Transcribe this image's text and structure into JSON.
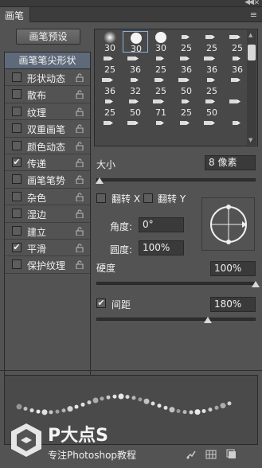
{
  "panel": {
    "tab_label": "画笔",
    "menu_icon": "panel-menu-icon"
  },
  "left": {
    "preset_button": "画笔预设",
    "header": "画笔笔尖形状",
    "options": [
      {
        "label": "形状动态",
        "checked": false,
        "checkmark": "",
        "locked": true
      },
      {
        "label": "散布",
        "checked": false,
        "checkmark": "",
        "locked": true
      },
      {
        "label": "纹理",
        "checked": false,
        "checkmark": "",
        "locked": true
      },
      {
        "label": "双重画笔",
        "checked": false,
        "checkmark": "",
        "locked": true
      },
      {
        "label": "颜色动态",
        "checked": false,
        "checkmark": "",
        "locked": true
      },
      {
        "label": "传递",
        "checked": true,
        "checkmark": "✔",
        "locked": true
      },
      {
        "label": "画笔笔势",
        "checked": false,
        "checkmark": "",
        "locked": true
      },
      {
        "label": "杂色",
        "checked": false,
        "checkmark": "",
        "locked": true
      },
      {
        "label": "湿边",
        "checked": false,
        "checkmark": "",
        "locked": true
      },
      {
        "label": "建立",
        "checked": false,
        "checkmark": "",
        "locked": true
      },
      {
        "label": "平滑",
        "checked": true,
        "checkmark": "✔",
        "locked": true
      },
      {
        "label": "保护纹理",
        "checked": false,
        "checkmark": "",
        "locked": true
      }
    ]
  },
  "brush_grid": {
    "rows": [
      [
        "30",
        "30",
        "30",
        "25",
        "25",
        "25"
      ],
      [
        "25",
        "36",
        "25",
        "36",
        "36",
        "36"
      ],
      [
        "36",
        "32",
        "25",
        "50",
        "25",
        ""
      ],
      [
        "25",
        "50",
        "71",
        "25",
        "50",
        ""
      ],
      [
        "",
        "",
        "",
        "",
        "",
        ""
      ]
    ],
    "selected_index": 1
  },
  "size": {
    "label": "大小",
    "value": "8 像素",
    "slider_fraction": 0.02
  },
  "flip": {
    "x_label": "翻转 X",
    "y_label": "翻转 Y",
    "x_checked": false,
    "y_checked": false
  },
  "angle": {
    "label": "角度:",
    "value": "0°"
  },
  "roundness": {
    "label": "圆度:",
    "value": "100%"
  },
  "hardness": {
    "label": "硬度",
    "value": "100%",
    "slider_fraction": 1.0
  },
  "spacing": {
    "label": "间距",
    "value": "180%",
    "checked": true,
    "checkmark": "✔",
    "slider_fraction": 0.7
  },
  "watermark": {
    "title": "P大点S",
    "subtitle": "专注Photoshop教程"
  },
  "footer_icons": [
    "brush-toggle-icon",
    "grid-icon",
    "new-preset-icon"
  ],
  "colors": {
    "panel_bg": "#535353",
    "header_highlight": "#5e6a7a"
  }
}
